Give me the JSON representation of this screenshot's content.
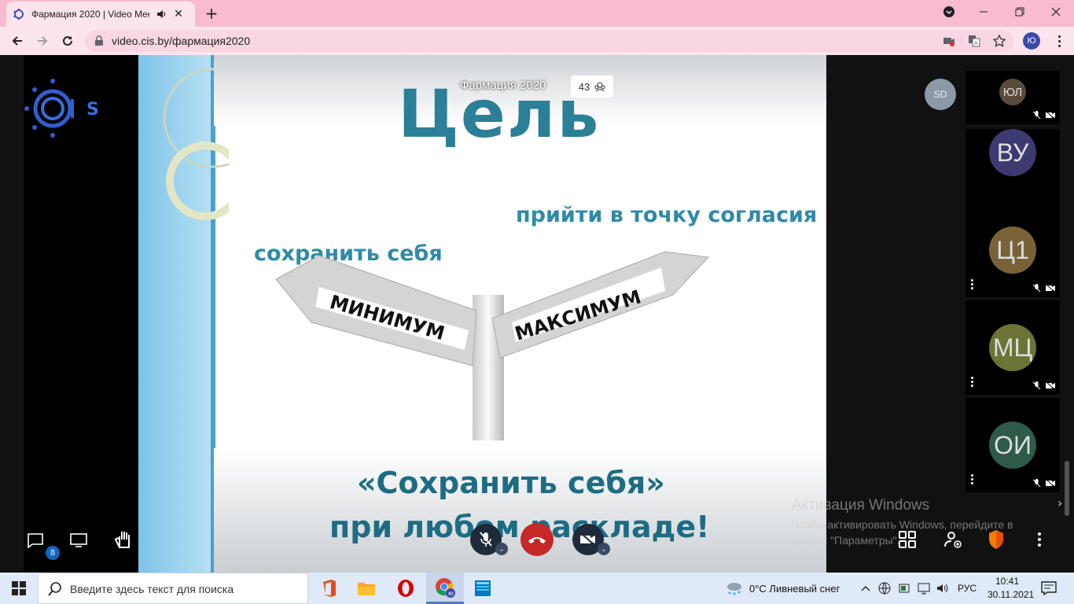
{
  "browser": {
    "tab_title": "Фармация 2020 | Video Mee",
    "url": "video.cis.by/фармация2020",
    "profile_initial": "Ю"
  },
  "meeting": {
    "name": "Фармация 2020",
    "participant_count": "43",
    "speaker_avatar": "SD",
    "logo_letters": "S",
    "chat_badge": "8"
  },
  "slide": {
    "title": "Цель",
    "text_right": "прийти в точку согласия",
    "text_left": "сохранить себя",
    "sign_left": "МИНИМУМ",
    "sign_right": "МАКСИМУМ",
    "bottom_line1": "«Сохранить себя»",
    "bottom_line2": "при любом раскладе!"
  },
  "participants": [
    {
      "initials": "ЮЛ",
      "color": "#5a4a3a"
    },
    {
      "initials": "ВУ",
      "color": "#3d3a72"
    },
    {
      "initials": "Ц1",
      "color": "#7a6238"
    },
    {
      "initials": "МЦ",
      "color": "#6b7336"
    },
    {
      "initials": "ОИ",
      "color": "#2e5a4a"
    }
  ],
  "watermark": {
    "title": "Активация Windows",
    "subtitle": "Чтобы активировать Windows, перейдите в раздел \"Параметры\"."
  },
  "taskbar": {
    "search_placeholder": "Введите здесь текст для поиска",
    "weather": "0°C  Ливневый снег",
    "language": "РУС",
    "time": "10:41",
    "date": "30.11.2021"
  }
}
